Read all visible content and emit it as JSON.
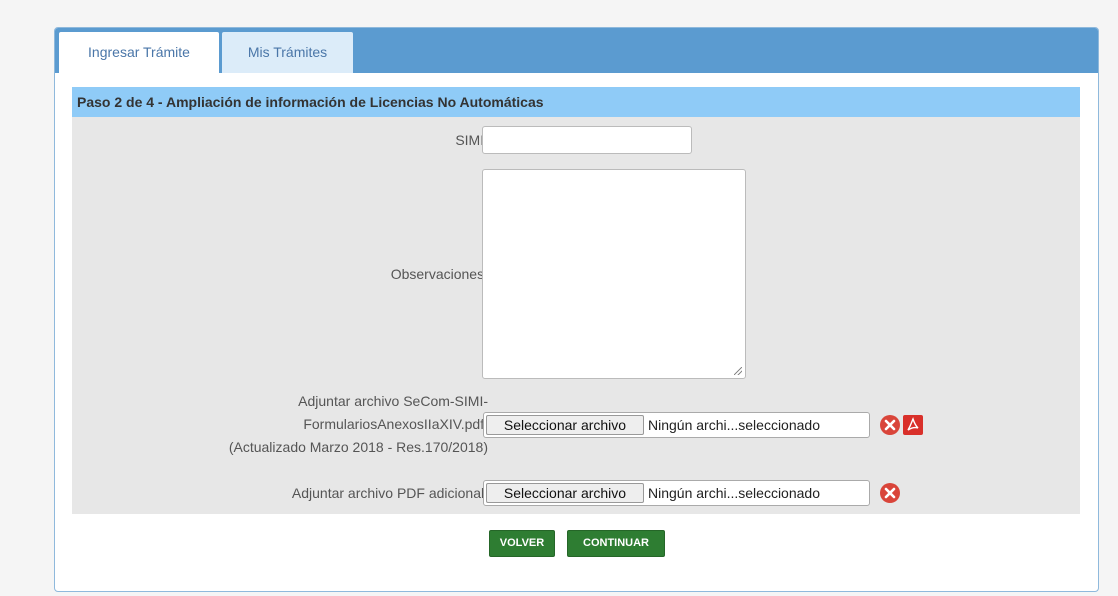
{
  "tabs": [
    {
      "label": "Ingresar Trámite",
      "active": true
    },
    {
      "label": "Mis Trámites",
      "active": false
    }
  ],
  "section": {
    "title": "Paso 2 de 4 - Ampliación de información de Licencias No Automáticas"
  },
  "form": {
    "simi_label": "SIMI:",
    "simi_value": "",
    "observaciones_label": "Observaciones:",
    "observaciones_value": "",
    "adjunto1_label_line1": "Adjuntar archivo SeCom-SIMI-",
    "adjunto1_label_line2": "FormulariosAnexosIIaXIV.pdf:",
    "adjunto1_label_line3": "(Actualizado Marzo 2018 - Res.170/2018)",
    "adjunto1_button": "Seleccionar archivo",
    "adjunto1_status": "Ningún archi...seleccionado",
    "adjunto2_label": "Adjuntar archivo PDF adicional:",
    "adjunto2_button": "Seleccionar archivo",
    "adjunto2_status": "Ningún archi...seleccionado"
  },
  "icons": {
    "remove": "remove-circle-icon",
    "pdf": "pdf-file-icon"
  },
  "actions": {
    "volver": "VOLVER",
    "continuar": "CONTINUAR"
  },
  "colors": {
    "tabbar": "#5b9bd0",
    "section_header": "#8fcbf7",
    "button": "#2e7d32",
    "remove": "#d9453a"
  }
}
